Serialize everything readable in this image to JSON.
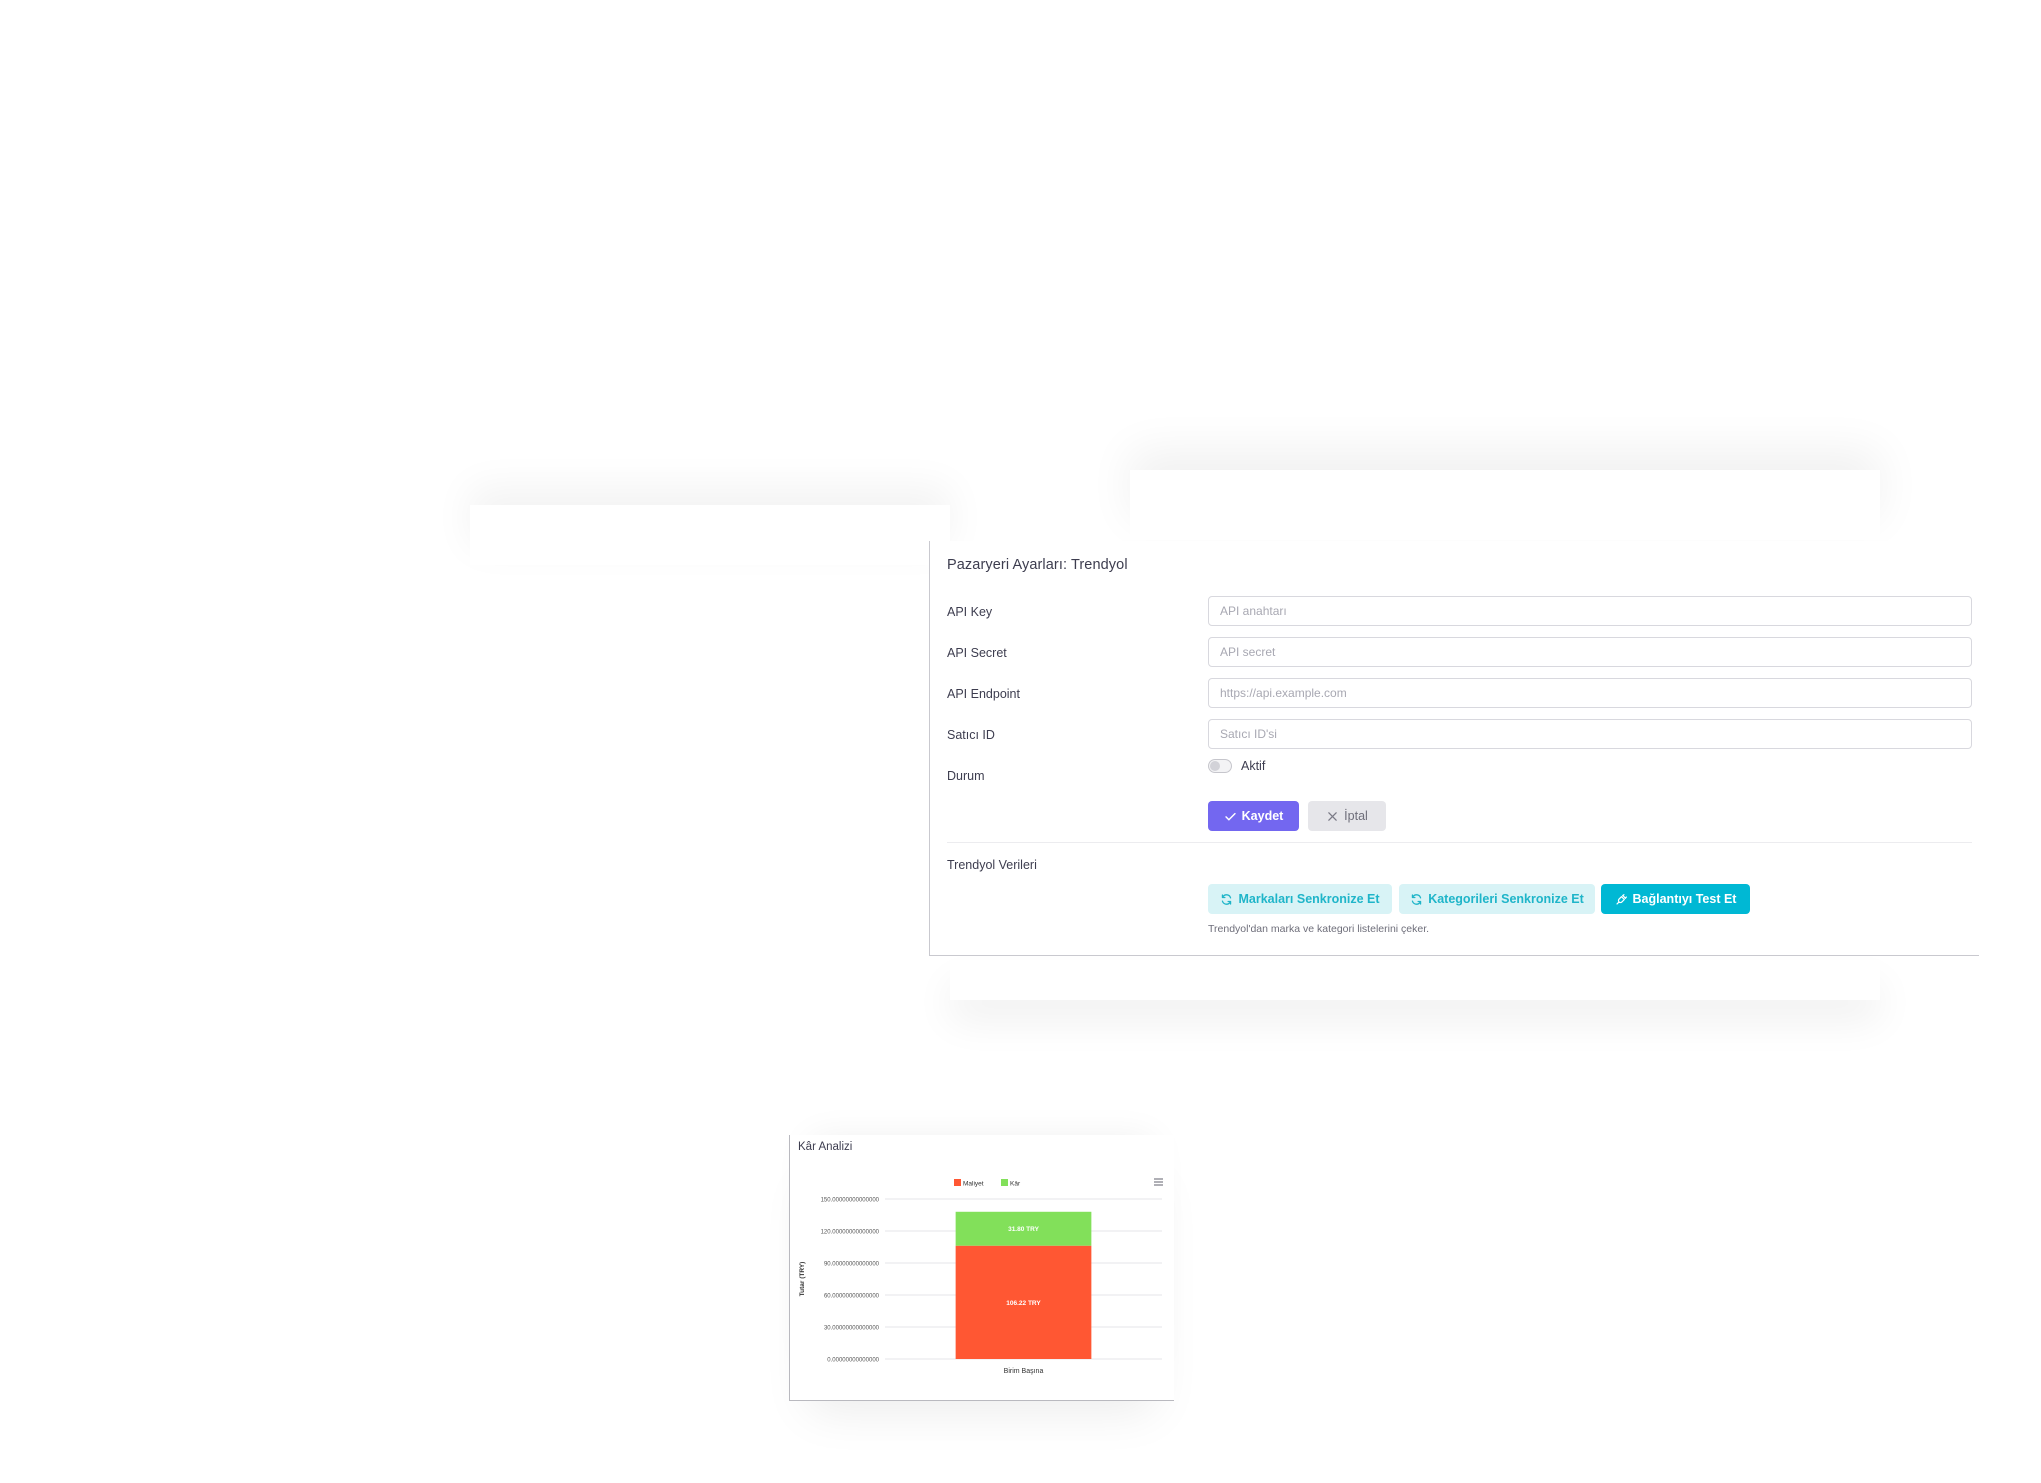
{
  "settings": {
    "title": "Pazaryeri Ayarları: Trendyol",
    "fields": [
      {
        "label": "API Key",
        "placeholder": "API anahtarı"
      },
      {
        "label": "API Secret",
        "placeholder": "API secret"
      },
      {
        "label": "API Endpoint",
        "placeholder": "https://api.example.com"
      },
      {
        "label": "Satıcı ID",
        "placeholder": "Satıcı ID'si"
      }
    ],
    "status_label": "Durum",
    "toggle_label": "Aktif",
    "toggle_on": false,
    "save_label": "Kaydet",
    "cancel_label": "İptal",
    "data_section_label": "Trendyol Verileri",
    "sync_brands_label": "Markaları Senkronize Et",
    "sync_categories_label": "Kategorileri Senkronize Et",
    "test_connection_label": "Bağlantıyı Test Et",
    "help_text": "Trendyol'dan marka ve kategori listelerini çeker.",
    "colors": {
      "primary": "#7367f0",
      "info": "#00b8d4",
      "info_light": "#d8f3f6"
    }
  },
  "chart_card": {
    "title": "Kâr Analizi",
    "menu_icon": "hamburger-menu-icon"
  },
  "chart_data": {
    "type": "bar",
    "stacked": true,
    "categories": [
      "Birim Başına"
    ],
    "series": [
      {
        "name": "Maliyet",
        "values": [
          106.22
        ],
        "color": "#ff5733",
        "label": "106.22 TRY"
      },
      {
        "name": "Kâr",
        "values": [
          31.8
        ],
        "color": "#82e05a",
        "label": "31.80 TRY"
      }
    ],
    "ylabel": "Tutar (TRY)",
    "xlabel": "",
    "ylim": [
      0,
      150
    ],
    "yticks": [
      {
        "value": 0,
        "label": "0.00000000000000"
      },
      {
        "value": 30,
        "label": "30.00000000000000"
      },
      {
        "value": 60,
        "label": "60.00000000000000"
      },
      {
        "value": 90,
        "label": "90.00000000000000"
      },
      {
        "value": 120,
        "label": "120.00000000000000"
      },
      {
        "value": 150,
        "label": "150.00000000000000"
      }
    ],
    "grid": true,
    "legend": "top-center"
  }
}
